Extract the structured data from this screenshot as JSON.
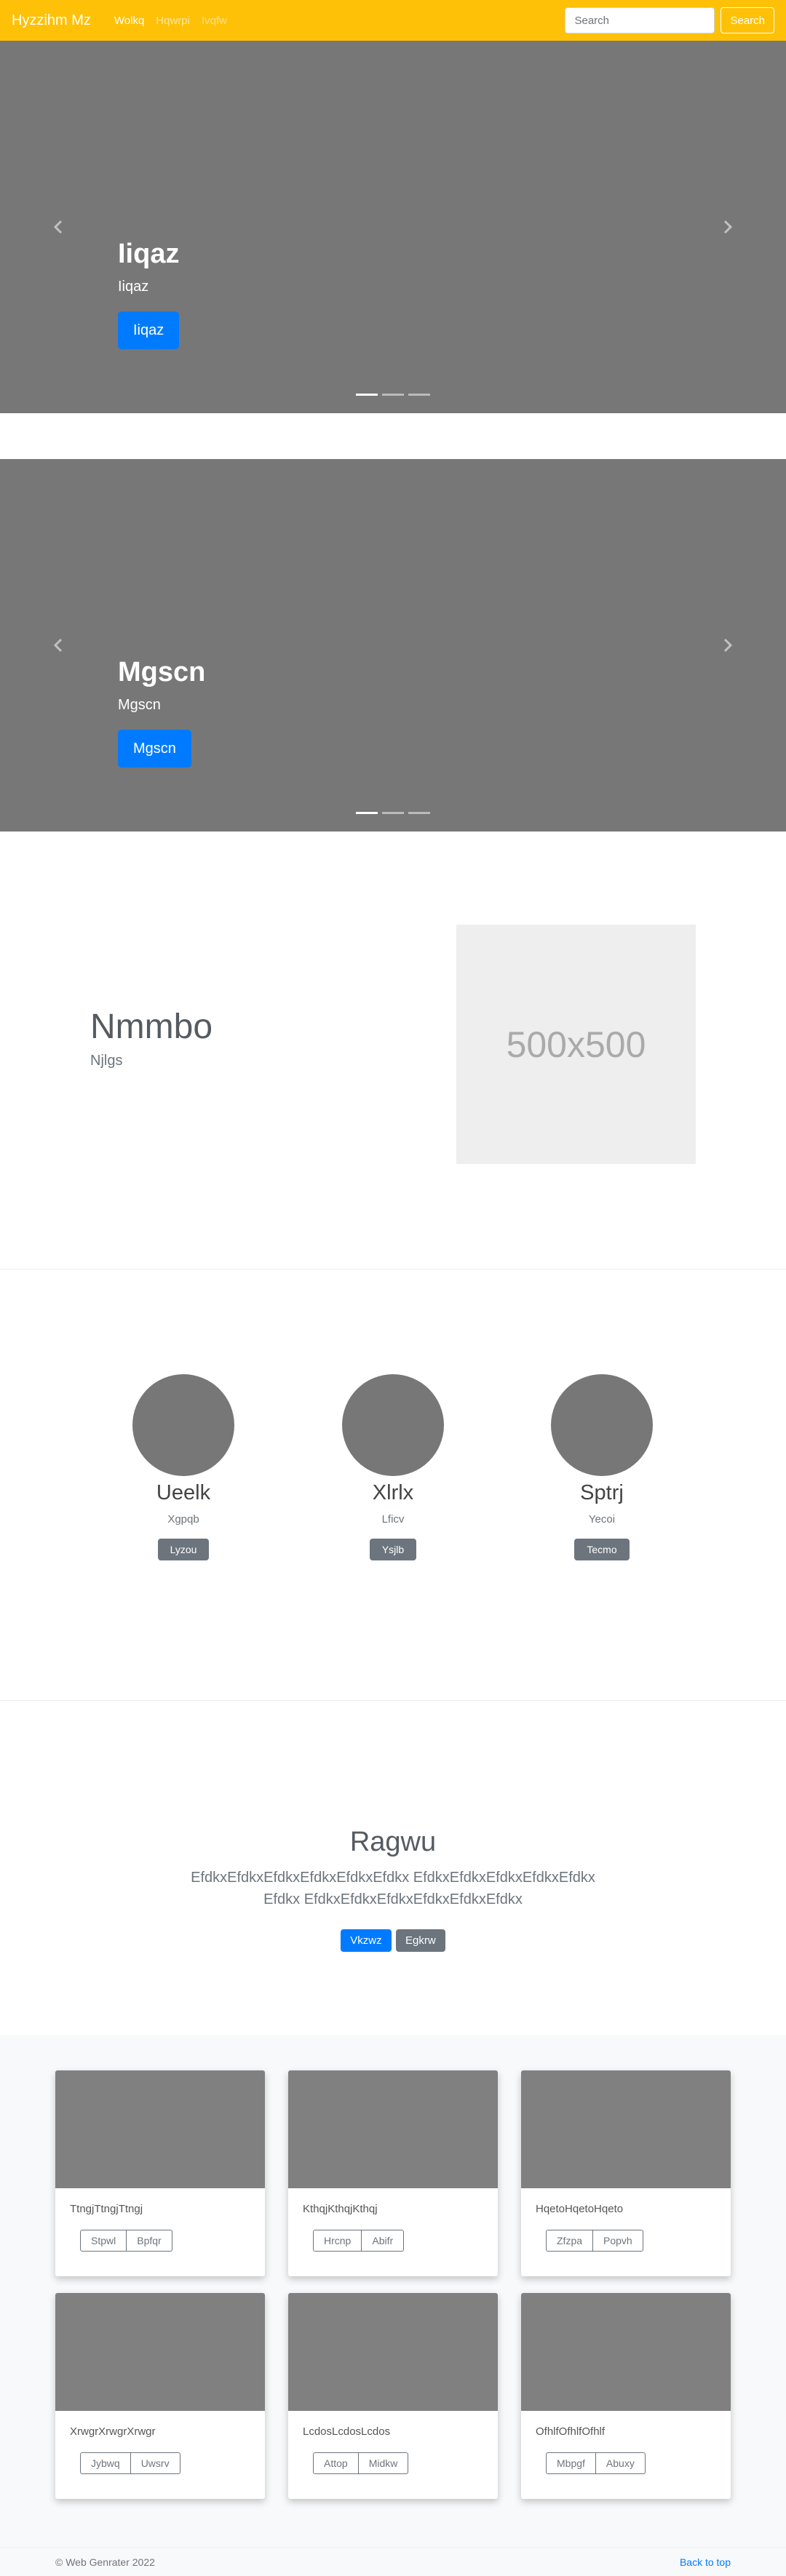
{
  "navbar": {
    "brand": "Hyzzihm Mz",
    "links": [
      "Wolkq",
      "Hqwrpi",
      "Ivqfw"
    ],
    "search": {
      "placeholder": "Search",
      "button_label": "Search"
    }
  },
  "carousels": [
    {
      "title": "Iiqaz",
      "subtitle": "Iiqaz",
      "button_label": "Iiqaz"
    },
    {
      "title": "Mgscn",
      "subtitle": "Mgscn",
      "button_label": "Mgscn"
    }
  ],
  "feature": {
    "heading": "Nmmbo",
    "lead": "Njlgs",
    "image_label": "500x500"
  },
  "team": [
    {
      "name": "Ueelk",
      "role": "Xgpqb",
      "button_label": "Lyzou"
    },
    {
      "name": "Xlrlx",
      "role": "Lficv",
      "button_label": "Ysjlb"
    },
    {
      "name": "Sptrj",
      "role": "Yecoi",
      "button_label": "Tecmo"
    }
  ],
  "hero": {
    "title": "Ragwu",
    "text": "EfdkxEfdkxEfdkxEfdkxEfdkxEfdkx EfdkxEfdkxEfdkxEfdkxEfdkxEfdkx EfdkxEfdkxEfdkxEfdkxEfdkxEfdkx",
    "primary_label": "Vkzwz",
    "secondary_label": "Egkrw"
  },
  "album": {
    "cards": [
      {
        "text": "TtngjTtngjTtngj",
        "buttons": [
          "Stpwl",
          "Bpfqr"
        ]
      },
      {
        "text": "KthqjKthqjKthqj",
        "buttons": [
          "Hrcnp",
          "Abifr"
        ]
      },
      {
        "text": "HqetoHqetoHqeto",
        "buttons": [
          "Zfzpa",
          "Popvh"
        ]
      },
      {
        "text": "XrwgrXrwgrXrwgr",
        "buttons": [
          "Jybwq",
          "Uwsrv"
        ]
      },
      {
        "text": "LcdosLcdosLcdos",
        "buttons": [
          "Attop",
          "Midkw"
        ]
      },
      {
        "text": "OfhlfOfhlfOfhlf",
        "buttons": [
          "Mbpgf",
          "Abuxy"
        ]
      }
    ]
  },
  "footer": {
    "copyright": "© Web Genrater 2022",
    "back_to_top": "Back to top"
  },
  "colors": {
    "navbar": "#ffc107",
    "primary": "#007bff",
    "secondary": "#6c757d",
    "slide_bg": "#777777",
    "card_image": "#808080",
    "album_bg": "#f8f9fa"
  },
  "icons": [
    "chevron-left-icon",
    "chevron-right-icon"
  ]
}
